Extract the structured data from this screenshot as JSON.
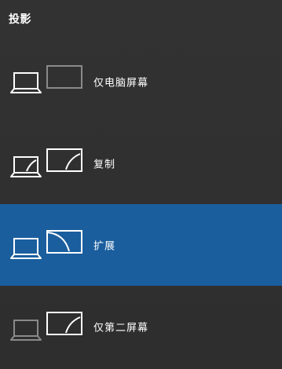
{
  "panel": {
    "title": "投影"
  },
  "options": [
    {
      "label": "仅电脑屏幕",
      "icon": "pc-screen-only-icon",
      "selected": false
    },
    {
      "label": "复制",
      "icon": "duplicate-icon",
      "selected": false
    },
    {
      "label": "扩展",
      "icon": "extend-icon",
      "selected": true
    },
    {
      "label": "仅第二屏幕",
      "icon": "second-screen-only-icon",
      "selected": false
    }
  ],
  "colors": {
    "background": "#2f2f2f",
    "selected": "#1a5e9e",
    "foreground": "#ffffff",
    "dimmed": "#8a8a8a"
  }
}
